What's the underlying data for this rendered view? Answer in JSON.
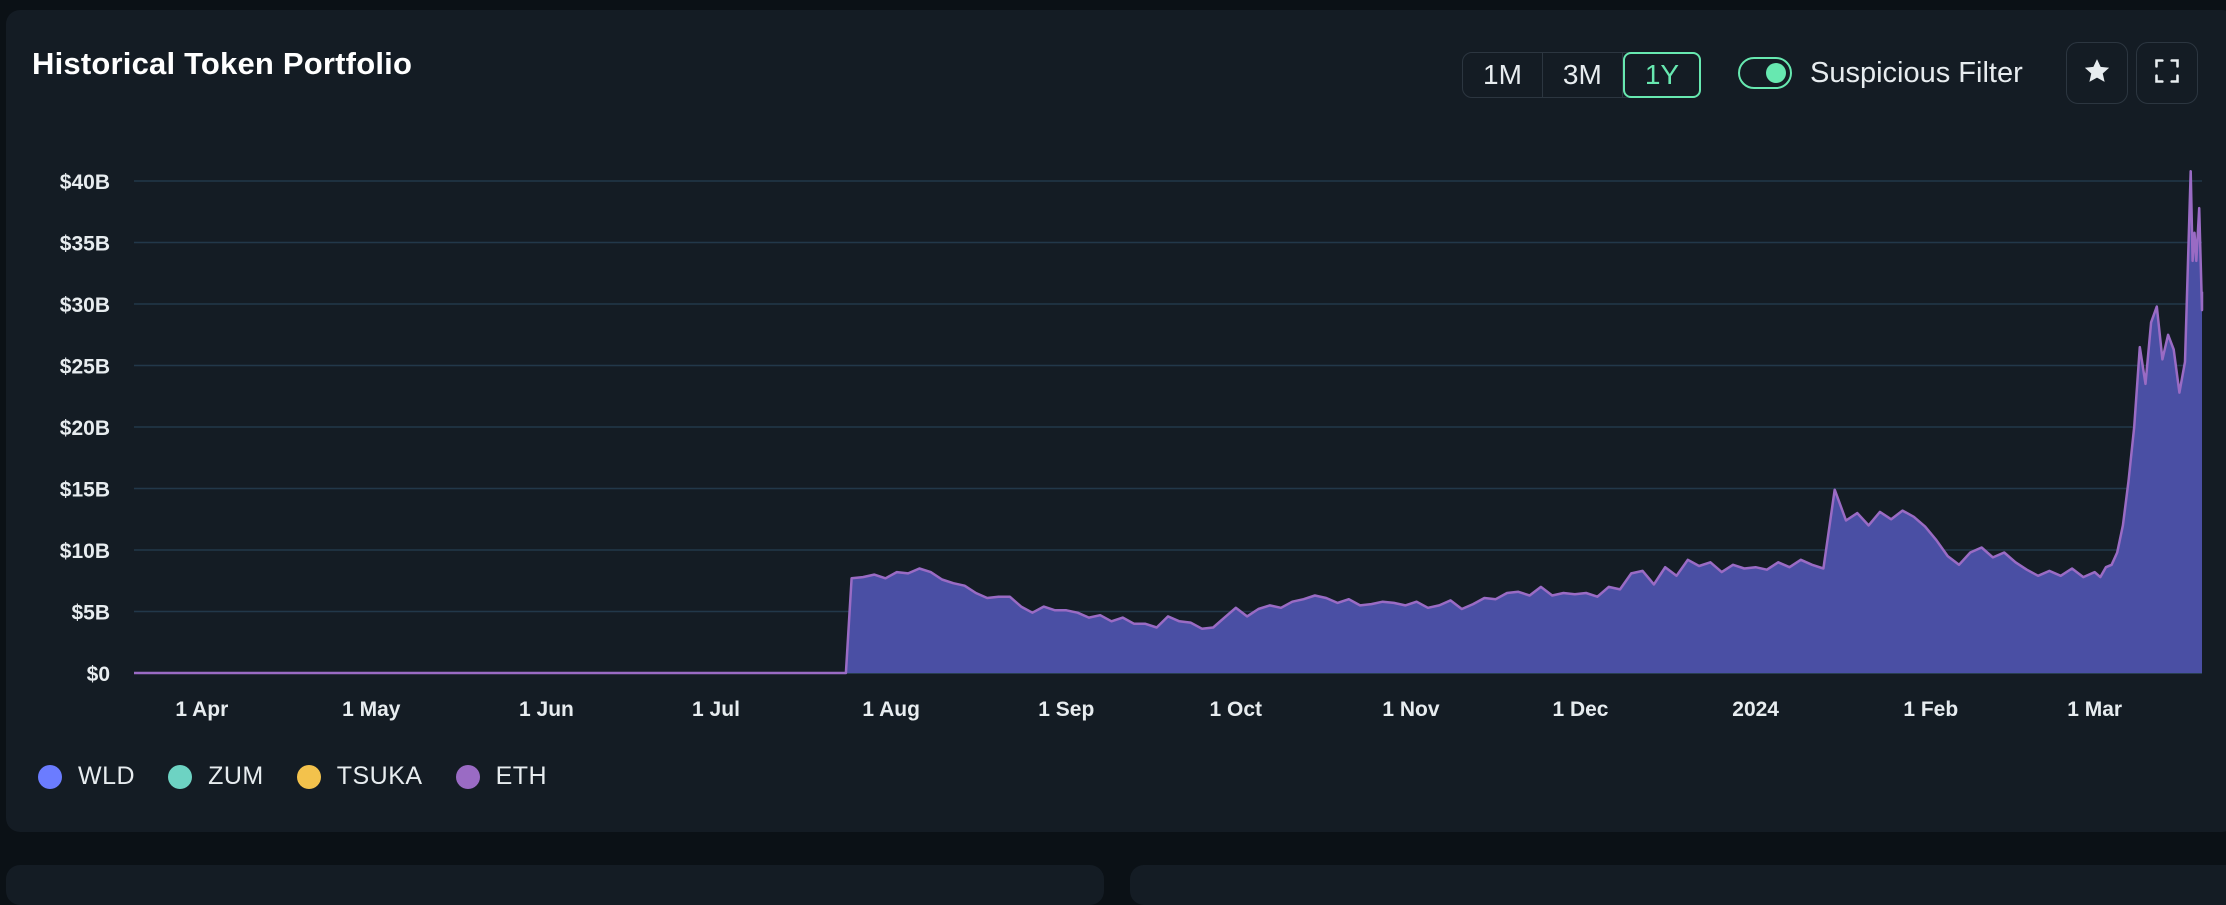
{
  "card": {
    "title": "Historical Token Portfolio"
  },
  "range": {
    "options": [
      "1M",
      "3M",
      "1Y"
    ],
    "selected": "1Y"
  },
  "filter": {
    "label": "Suspicious Filter",
    "enabled": true
  },
  "icons": {
    "favorite": "star-icon",
    "fullscreen": "expand-icon"
  },
  "colors": {
    "accent": "#67e8b0",
    "area_fill": "#4a4fa4",
    "area_stroke": "#9a6bc4",
    "grid": "#22384a"
  },
  "chart_data": {
    "type": "area",
    "title": "Historical Token Portfolio",
    "y_ticks": [
      "$40B",
      "$35B",
      "$30B",
      "$25B",
      "$20B",
      "$15B",
      "$10B",
      "$5B",
      "$0"
    ],
    "y_range": [
      0,
      40
    ],
    "y_unit": "$B",
    "x_ticks": [
      "1 Apr",
      "1 May",
      "1 Jun",
      "1 Jul",
      "1 Aug",
      "1 Sep",
      "1 Oct",
      "1 Nov",
      "1 Dec",
      "2024",
      "1 Feb",
      "1 Mar"
    ],
    "x_range": [
      "2023-03-20",
      "2024-03-20"
    ],
    "grid": true,
    "legend_position": "bottom-left",
    "series": [
      {
        "name": "WLD",
        "color": "#6b7cff",
        "values": []
      },
      {
        "name": "ZUM",
        "color": "#6dd3c3",
        "values": []
      },
      {
        "name": "TSUKA",
        "color": "#f3c24c",
        "values": []
      },
      {
        "name": "ETH",
        "color": "#9a6bc4",
        "points": [
          [
            "2023-03-20",
            0
          ],
          [
            "2023-07-24",
            0
          ],
          [
            "2023-07-25",
            7.7
          ],
          [
            "2023-07-27",
            7.8
          ],
          [
            "2023-07-29",
            8.0
          ],
          [
            "2023-07-31",
            7.7
          ],
          [
            "2023-08-02",
            8.2
          ],
          [
            "2023-08-04",
            8.1
          ],
          [
            "2023-08-06",
            8.5
          ],
          [
            "2023-08-08",
            8.2
          ],
          [
            "2023-08-10",
            7.6
          ],
          [
            "2023-08-12",
            7.3
          ],
          [
            "2023-08-14",
            7.1
          ],
          [
            "2023-08-16",
            6.5
          ],
          [
            "2023-08-18",
            6.1
          ],
          [
            "2023-08-20",
            6.2
          ],
          [
            "2023-08-22",
            6.2
          ],
          [
            "2023-08-24",
            5.4
          ],
          [
            "2023-08-26",
            4.9
          ],
          [
            "2023-08-28",
            5.4
          ],
          [
            "2023-08-30",
            5.1
          ],
          [
            "2023-09-01",
            5.1
          ],
          [
            "2023-09-03",
            4.9
          ],
          [
            "2023-09-05",
            4.5
          ],
          [
            "2023-09-07",
            4.7
          ],
          [
            "2023-09-09",
            4.2
          ],
          [
            "2023-09-11",
            4.5
          ],
          [
            "2023-09-13",
            4.0
          ],
          [
            "2023-09-15",
            4.0
          ],
          [
            "2023-09-17",
            3.7
          ],
          [
            "2023-09-19",
            4.6
          ],
          [
            "2023-09-21",
            4.2
          ],
          [
            "2023-09-23",
            4.1
          ],
          [
            "2023-09-25",
            3.6
          ],
          [
            "2023-09-27",
            3.7
          ],
          [
            "2023-09-29",
            4.5
          ],
          [
            "2023-10-01",
            5.3
          ],
          [
            "2023-10-03",
            4.6
          ],
          [
            "2023-10-05",
            5.2
          ],
          [
            "2023-10-07",
            5.5
          ],
          [
            "2023-10-09",
            5.3
          ],
          [
            "2023-10-11",
            5.8
          ],
          [
            "2023-10-13",
            6.0
          ],
          [
            "2023-10-15",
            6.3
          ],
          [
            "2023-10-17",
            6.1
          ],
          [
            "2023-10-19",
            5.7
          ],
          [
            "2023-10-21",
            6.0
          ],
          [
            "2023-10-23",
            5.5
          ],
          [
            "2023-10-25",
            5.6
          ],
          [
            "2023-10-27",
            5.8
          ],
          [
            "2023-10-29",
            5.7
          ],
          [
            "2023-10-31",
            5.5
          ],
          [
            "2023-11-02",
            5.8
          ],
          [
            "2023-11-04",
            5.3
          ],
          [
            "2023-11-06",
            5.5
          ],
          [
            "2023-11-08",
            5.9
          ],
          [
            "2023-11-10",
            5.2
          ],
          [
            "2023-11-12",
            5.6
          ],
          [
            "2023-11-14",
            6.1
          ],
          [
            "2023-11-16",
            6.0
          ],
          [
            "2023-11-18",
            6.5
          ],
          [
            "2023-11-20",
            6.6
          ],
          [
            "2023-11-22",
            6.3
          ],
          [
            "2023-11-24",
            7.0
          ],
          [
            "2023-11-26",
            6.3
          ],
          [
            "2023-11-28",
            6.5
          ],
          [
            "2023-11-30",
            6.4
          ],
          [
            "2023-12-02",
            6.5
          ],
          [
            "2023-12-04",
            6.2
          ],
          [
            "2023-12-06",
            7.0
          ],
          [
            "2023-12-08",
            6.8
          ],
          [
            "2023-12-10",
            8.1
          ],
          [
            "2023-12-12",
            8.3
          ],
          [
            "2023-12-14",
            7.2
          ],
          [
            "2023-12-16",
            8.6
          ],
          [
            "2023-12-18",
            7.9
          ],
          [
            "2023-12-20",
            9.2
          ],
          [
            "2023-12-22",
            8.7
          ],
          [
            "2023-12-24",
            9.0
          ],
          [
            "2023-12-26",
            8.2
          ],
          [
            "2023-12-28",
            8.8
          ],
          [
            "2023-12-30",
            8.5
          ],
          [
            "2024-01-01",
            8.6
          ],
          [
            "2024-01-03",
            8.4
          ],
          [
            "2024-01-05",
            9.0
          ],
          [
            "2024-01-07",
            8.6
          ],
          [
            "2024-01-09",
            9.2
          ],
          [
            "2024-01-11",
            8.8
          ],
          [
            "2024-01-13",
            8.5
          ],
          [
            "2024-01-15",
            14.9
          ],
          [
            "2024-01-17",
            12.4
          ],
          [
            "2024-01-19",
            13.0
          ],
          [
            "2024-01-21",
            12.0
          ],
          [
            "2024-01-23",
            13.1
          ],
          [
            "2024-01-25",
            12.5
          ],
          [
            "2024-01-27",
            13.2
          ],
          [
            "2024-01-29",
            12.7
          ],
          [
            "2024-01-31",
            11.9
          ],
          [
            "2024-02-02",
            10.8
          ],
          [
            "2024-02-04",
            9.5
          ],
          [
            "2024-02-06",
            8.8
          ],
          [
            "2024-02-08",
            9.8
          ],
          [
            "2024-02-10",
            10.2
          ],
          [
            "2024-02-12",
            9.4
          ],
          [
            "2024-02-14",
            9.8
          ],
          [
            "2024-02-16",
            9.0
          ],
          [
            "2024-02-18",
            8.4
          ],
          [
            "2024-02-20",
            7.9
          ],
          [
            "2024-02-22",
            8.3
          ],
          [
            "2024-02-24",
            7.9
          ],
          [
            "2024-02-26",
            8.5
          ],
          [
            "2024-02-28",
            7.8
          ],
          [
            "2024-03-01",
            8.2
          ],
          [
            "2024-03-02",
            7.8
          ],
          [
            "2024-03-03",
            8.6
          ],
          [
            "2024-03-04",
            8.8
          ],
          [
            "2024-03-05",
            9.8
          ],
          [
            "2024-03-06",
            12.0
          ],
          [
            "2024-03-07",
            15.6
          ],
          [
            "2024-03-08",
            20.0
          ],
          [
            "2024-03-09",
            26.5
          ],
          [
            "2024-03-10",
            23.5
          ],
          [
            "2024-03-11",
            28.5
          ],
          [
            "2024-03-12",
            29.8
          ],
          [
            "2024-03-13",
            25.5
          ],
          [
            "2024-03-14",
            27.5
          ],
          [
            "2024-03-15",
            26.3
          ],
          [
            "2024-03-16",
            22.8
          ],
          [
            "2024-03-17",
            25.3
          ],
          [
            "2024-03-18",
            40.8
          ],
          [
            "2024-03-18T08",
            33.5
          ],
          [
            "2024-03-18T16",
            35.8
          ],
          [
            "2024-03-19",
            33.5
          ],
          [
            "2024-03-19T12",
            37.8
          ],
          [
            "2024-03-20",
            29.5
          ],
          [
            "2024-03-20T12",
            31.0
          ]
        ]
      }
    ]
  },
  "legend": [
    {
      "label": "WLD",
      "color": "#6b7cff"
    },
    {
      "label": "ZUM",
      "color": "#6dd3c3"
    },
    {
      "label": "TSUKA",
      "color": "#f3c24c"
    },
    {
      "label": "ETH",
      "color": "#9a6bc4"
    }
  ]
}
